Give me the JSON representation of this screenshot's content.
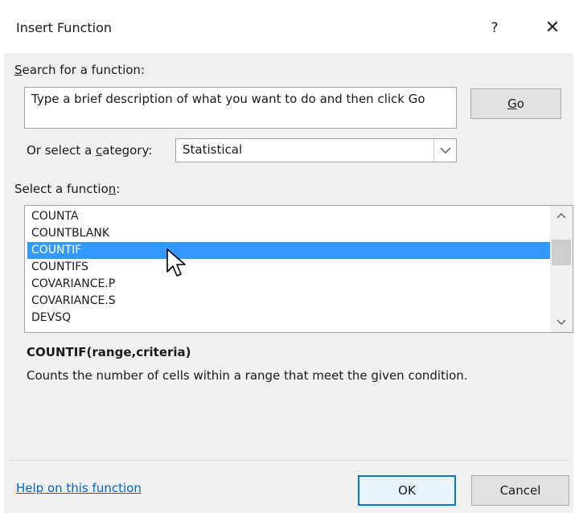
{
  "window": {
    "title": "Insert Function",
    "help_glyph": "?",
    "close_glyph": "✕"
  },
  "search": {
    "label_accel": "S",
    "label_rest": "earch for a function:",
    "value": "Type a brief description of what you want to do and then click Go",
    "go_accel": "G",
    "go_rest": "o"
  },
  "category": {
    "label_pre": "Or select a ",
    "label_accel": "c",
    "label_post": "ategory:",
    "selected": "Statistical"
  },
  "functions": {
    "label_pre": "Select a functio",
    "label_accel": "n",
    "label_post": ":",
    "items": [
      "COUNTA",
      "COUNTBLANK",
      "COUNTIF",
      "COUNTIFS",
      "COVARIANCE.P",
      "COVARIANCE.S",
      "DEVSQ"
    ],
    "selected_item": "COUNTIF"
  },
  "details": {
    "signature": "COUNTIF(range,criteria)",
    "description": "Counts the number of cells within a range that meet the given condition."
  },
  "footer": {
    "help_link": "Help on this function",
    "ok": "OK",
    "cancel": "Cancel"
  },
  "colors": {
    "selection": "#3399ff",
    "link": "#0066cc",
    "default_button_border": "#0078d7"
  },
  "icons": [
    "help-icon",
    "close-icon",
    "chevron-down-icon",
    "scroll-up-arrow-icon",
    "scroll-down-arrow-icon",
    "mouse-pointer-icon"
  ]
}
